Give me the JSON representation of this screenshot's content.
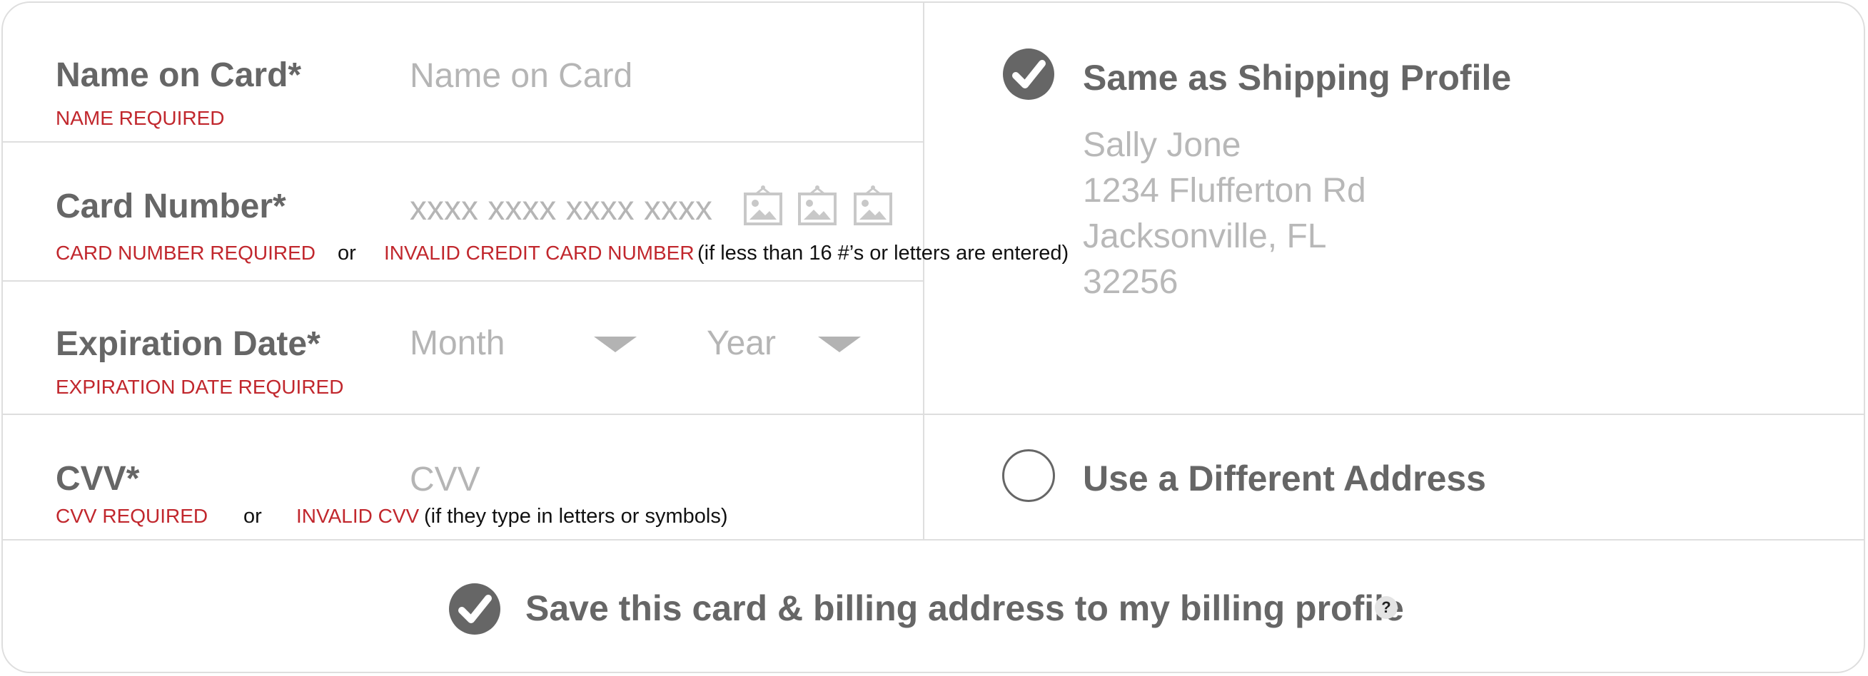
{
  "name_field": {
    "label": "Name on Card*",
    "placeholder": "Name on Card",
    "error": "NAME REQUIRED"
  },
  "card_number_field": {
    "label": "Card Number*",
    "placeholder": "xxxx xxxx xxxx xxxx",
    "error_required": "CARD NUMBER REQUIRED",
    "or_text": "or",
    "error_invalid": "INVALID CREDIT CARD NUMBER",
    "invalid_note": "(if less than 16 #’s or letters are entered)",
    "card_icons": [
      "card-type-image-icon",
      "card-type-image-icon",
      "card-type-image-icon"
    ]
  },
  "expiration_field": {
    "label": "Expiration Date*",
    "month_value": "Month",
    "year_value": "Year",
    "error": "EXPIRATION DATE REQUIRED"
  },
  "cvv_field": {
    "label": "CVV*",
    "placeholder": "CVV",
    "error_required": "CVV REQUIRED",
    "or_text": "or",
    "error_invalid": "INVALID CVV",
    "invalid_note": "(if they type in letters or symbols)"
  },
  "billing_address": {
    "same_as_shipping": {
      "label": "Same as Shipping Profile",
      "checked": true
    },
    "shipping_address": {
      "name": "Sally Jone",
      "street": "1234 Flufferton Rd",
      "city_state": "Jacksonville, FL",
      "zip": "32256"
    },
    "different_address": {
      "label": "Use a Different Address",
      "checked": false
    }
  },
  "save_option": {
    "label": "Save this card & billing address to my billing profile",
    "checked": true,
    "help_text": "?"
  },
  "colors": {
    "label_gray": "#666666",
    "placeholder_gray": "#b5b5b5",
    "error_red": "#c1272d",
    "divider": "#dedede"
  }
}
